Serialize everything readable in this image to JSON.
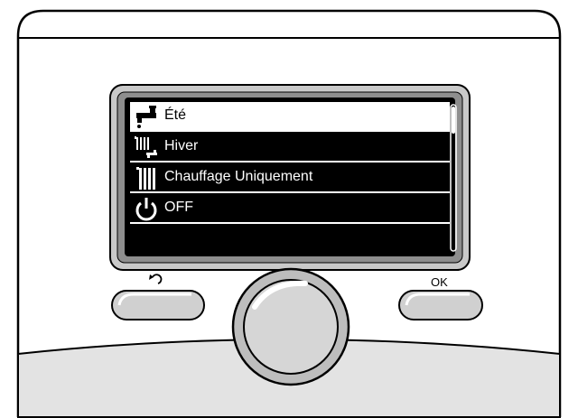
{
  "screen": {
    "menu": {
      "items": [
        {
          "label": "Été",
          "icon": "summer-tap-icon",
          "selected": true
        },
        {
          "label": "Hiver",
          "icon": "winter-radiator-tap-icon",
          "selected": false
        },
        {
          "label": "Chauffage Uniquement",
          "icon": "radiator-icon",
          "selected": false
        },
        {
          "label": "OFF",
          "icon": "power-icon",
          "selected": false
        }
      ]
    }
  },
  "controls": {
    "back_button": {
      "symbol": "↺",
      "icon": "back-arrow-icon"
    },
    "ok_button": {
      "label": "OK"
    },
    "dial": {
      "icon": "rotary-dial"
    }
  },
  "colors": {
    "screen_bg": "#000000",
    "highlight": "#ffffff",
    "bezel": "#cccccc",
    "panel_bottom": "#e3e3e3"
  }
}
